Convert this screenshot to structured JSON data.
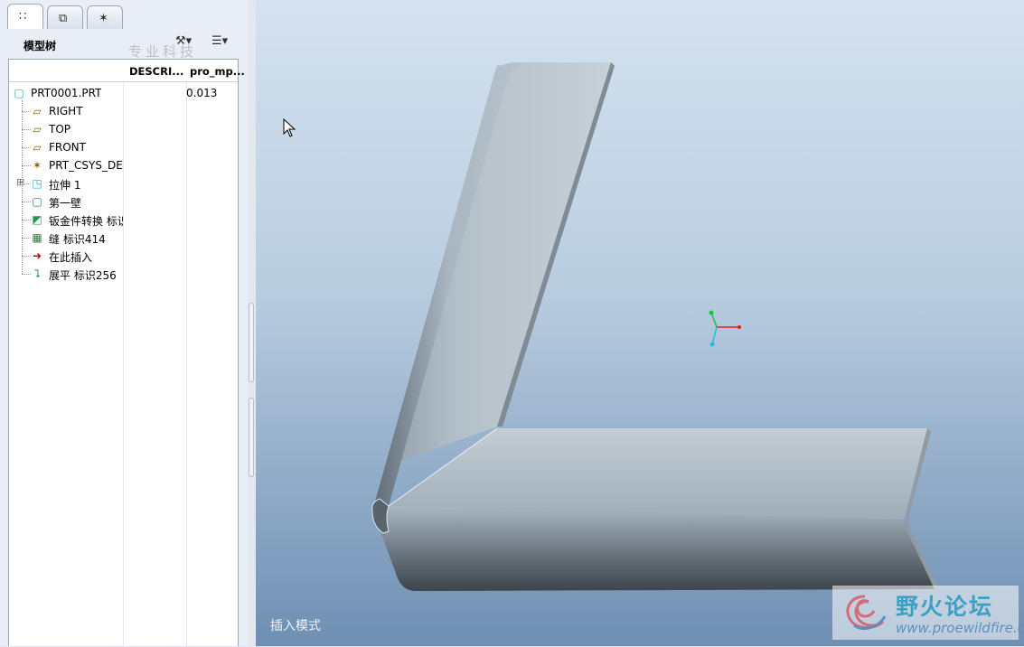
{
  "tabs": [
    {
      "name": "model-tree-tab",
      "icon": "model-tree-icon",
      "glyph": "∷",
      "active": true
    },
    {
      "name": "layers-tab",
      "icon": "layers-icon",
      "glyph": "⧉",
      "active": false
    },
    {
      "name": "favorites-tab",
      "icon": "folder-star-icon",
      "glyph": "✶",
      "active": false
    }
  ],
  "panel": {
    "title": "模型树",
    "watermark": "专业科技",
    "settings_icon": "⚒▾",
    "show_icon": "☰▾"
  },
  "tree": {
    "columns": [
      "DESCRI...",
      "pro_mp..."
    ],
    "items": [
      {
        "label": "PRT0001.PRT",
        "value": "0.013",
        "icon": "part-icon",
        "glyph": "▢",
        "color": "#2aa7c9",
        "level": 0
      },
      {
        "label": "RIGHT",
        "icon": "datum-plane-icon",
        "glyph": "▱",
        "color": "#8a5a00",
        "level": 1
      },
      {
        "label": "TOP",
        "icon": "datum-plane-icon",
        "glyph": "▱",
        "color": "#8a5a00",
        "level": 1
      },
      {
        "label": "FRONT",
        "icon": "datum-plane-icon",
        "glyph": "▱",
        "color": "#8a5a00",
        "level": 1
      },
      {
        "label": "PRT_CSYS_DEF",
        "icon": "coordinate-system-icon",
        "glyph": "✶",
        "color": "#8a5a00",
        "level": 1
      },
      {
        "label": "拉伸 1",
        "icon": "extrude-icon",
        "glyph": "◳",
        "color": "#2aa7c9",
        "level": 1,
        "expandable": true
      },
      {
        "label": "第一壁",
        "icon": "first-wall-icon",
        "glyph": "▢",
        "color": "#2a6f8f",
        "level": 1
      },
      {
        "label": "钣金件转换 标识",
        "icon": "sheetmetal-convert-icon",
        "glyph": "◩",
        "color": "#1f9a5a",
        "level": 1
      },
      {
        "label": "缝 标识414",
        "icon": "rip-icon",
        "glyph": "▦",
        "color": "#2f7d3c",
        "level": 1
      },
      {
        "label": "在此插入",
        "icon": "insert-here-arrow-icon",
        "glyph": "➜",
        "color": "#c00000",
        "level": 1
      },
      {
        "label": "展平 标识256",
        "icon": "unbend-icon",
        "glyph": "⮧",
        "color": "#1f9a5a",
        "level": 1
      }
    ]
  },
  "viewport": {
    "mode_text": "插入模式",
    "watermark_title": "野火论坛",
    "watermark_url": "www.proewildfire.cn"
  },
  "colors": {
    "csys_x": "#e02020",
    "csys_y": "#20c040",
    "csys_z": "#20c0d0"
  }
}
